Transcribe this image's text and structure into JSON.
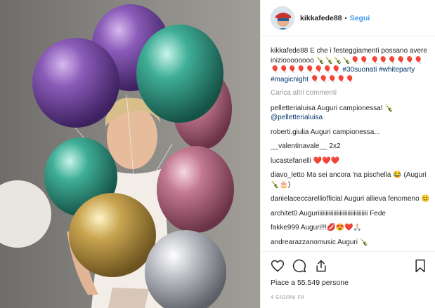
{
  "post": {
    "username": "kikkafede88",
    "separator": "•",
    "follow_label": "Segui",
    "caption_user": "kikkafede88",
    "caption_text": "E che i festeggiamenti possano avere inizioooooooo 🍾🍾🍾🍾🎈🎈 🎈🎈🎈🎈🎈🎈🎈🎈🎈🎈🎈🎈🎈🎈",
    "caption_hashtags": "#30suonati #whiteparty #magicnight 🎈🎈🎈🎈🎈",
    "load_more": "Carica altri commenti",
    "likes": "Piace a 55.549 persone",
    "time": "4 GIORNI FA"
  },
  "comments": [
    {
      "user": "pelletterialuisa",
      "text": "Auguri campionessa! 🍾",
      "mention": "@pelletterialuisa"
    },
    {
      "user": "roberti.giulia",
      "text": "Auguri campionessa..."
    },
    {
      "user": "__valentinavale__",
      "text": "2x2"
    },
    {
      "user": "lucastefanelli",
      "text": "❤️❤️❤️"
    },
    {
      "user": "diavo_letto",
      "text": "Ma sei ancora 'na pischella 😂 (Auguri 🍾🎂)"
    },
    {
      "user": "danielaceccarelliofficial",
      "text": "Auguri allieva fenomeno 😊"
    },
    {
      "user": "architet0",
      "text": "Auguriiiiiiiiiiiiiiiiiiiiiiiiiiiiiiii Fede"
    },
    {
      "user": "fakke999",
      "text": "Auguri!!!💋😍❤️🙏🏻"
    },
    {
      "user": "andrearazzanomusic",
      "text": "Auguri 🍾"
    }
  ],
  "icons": {
    "like": "heart-icon",
    "comment": "comment-icon",
    "share": "share-icon",
    "save": "bookmark-icon"
  }
}
